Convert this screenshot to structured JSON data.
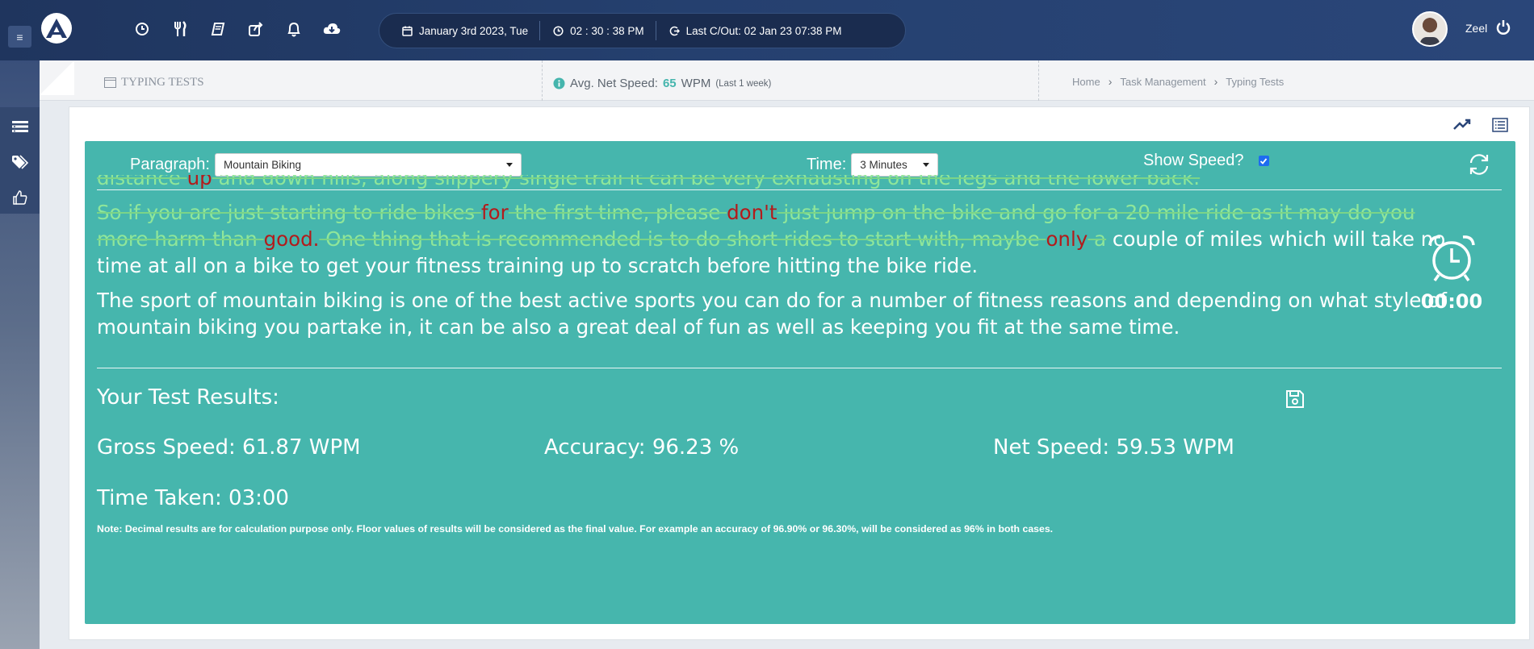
{
  "topbar": {
    "menu_icon": "hamburger-icon",
    "logo": "app-logo",
    "icons": [
      "clock-icon",
      "utensils-icon",
      "book-icon",
      "share-icon",
      "bell-icon",
      "cloud-download-icon"
    ],
    "date": "January 3rd 2023, Tue",
    "time": "02 : 30 : 38 PM",
    "last_checkout": "Last C/Out: 02 Jan 23 07:38 PM",
    "user_name": "Zeel"
  },
  "rail": {
    "icons": [
      "list-icon",
      "tags-icon",
      "thumbs-up-icon"
    ]
  },
  "subbar": {
    "page_title": "TYPING TESTS",
    "avg_label": "Avg. Net Speed:",
    "avg_value": "65",
    "avg_unit": "WPM",
    "avg_period": "(Last 1 week)",
    "breadcrumbs": [
      "Home",
      "Task Management",
      "Typing Tests"
    ]
  },
  "controls": {
    "paragraph_label": "Paragraph:",
    "paragraph_value": "Mountain Biking",
    "time_label": "Time:",
    "time_value": "3 Minutes",
    "show_speed_label": "Show Speed?",
    "show_speed_checked": true
  },
  "typing": {
    "p1": [
      {
        "t": "distance ",
        "s": "done"
      },
      {
        "t": "up",
        "s": "err"
      },
      {
        "t": " and down hills, along slippery single trail it can be very exhausting on the legs and the lower back.",
        "s": "done"
      }
    ],
    "p2": [
      {
        "t": "So if you are just starting to ride bikes ",
        "s": "done"
      },
      {
        "t": "for",
        "s": "err"
      },
      {
        "t": " the first time, please ",
        "s": "done"
      },
      {
        "t": "don't",
        "s": "err"
      },
      {
        "t": " just jump on the bike and go for a 20 mile ride as it may do you more harm than ",
        "s": "done"
      },
      {
        "t": "good.",
        "s": "err"
      },
      {
        "t": " One thing that is recommended is to do short rides to start with, maybe ",
        "s": "done"
      },
      {
        "t": "only",
        "s": "err"
      },
      {
        "t": " a",
        "s": "done"
      },
      {
        "t": " couple of miles which will take no time at all on a bike to get your fitness training up to scratch before hitting the bike ride.",
        "s": "pending"
      }
    ],
    "p3": "The sport of mountain biking is one of the best active sports you can do for a number of fitness reasons and depending on what style of mountain biking you partake in, it can be also a great deal of fun as well as keeping you fit at the same time."
  },
  "timer": {
    "value": "00:00"
  },
  "results": {
    "title": "Your Test Results:",
    "gross": "Gross Speed: 61.87 WPM",
    "accuracy": "Accuracy: 96.23 %",
    "net": "Net Speed: 59.53 WPM",
    "time_taken": "Time Taken: 03:00",
    "note": "Note: Decimal results are for calculation purpose only. Floor values of results will be considered as the final value. For example an accuracy of 96.90% or 96.30%, will be considered as 96% in both cases."
  },
  "colors": {
    "panel": "#46b6ad",
    "typed_correct": "#8fe69a",
    "typed_error": "#b31b1b",
    "topbar": "#23396a"
  }
}
